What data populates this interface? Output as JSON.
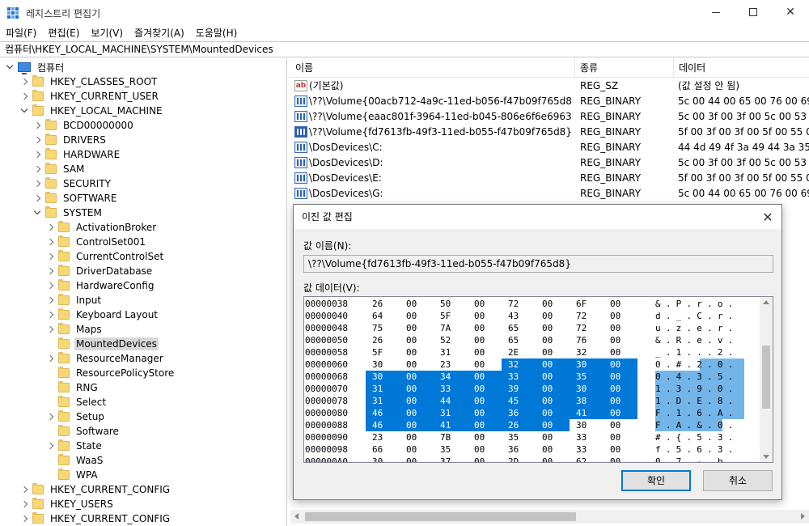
{
  "window": {
    "title": "레지스트리 편집기"
  },
  "menu": [
    "파일(F)",
    "편집(E)",
    "보기(V)",
    "즐겨찾기(A)",
    "도움말(H)"
  ],
  "address": "컴퓨터\\HKEY_LOCAL_MACHINE\\SYSTEM\\MountedDevices",
  "tree": {
    "root": "컴퓨터",
    "hives": [
      "HKEY_CLASSES_ROOT",
      "HKEY_CURRENT_USER",
      "HKEY_LOCAL_MACHINE",
      "HKEY_USERS",
      "HKEY_CURRENT_CONFIG"
    ],
    "hklm_children": [
      "BCD00000000",
      "DRIVERS",
      "HARDWARE",
      "SAM",
      "SECURITY",
      "SOFTWARE",
      "SYSTEM"
    ],
    "system_children": [
      "ActivationBroker",
      "ControlSet001",
      "CurrentControlSet",
      "DriverDatabase",
      "HardwareConfig",
      "Input",
      "Keyboard Layout",
      "Maps",
      "MountedDevices",
      "ResourceManager",
      "ResourcePolicyStore",
      "RNG",
      "Select",
      "Setup",
      "Software",
      "State",
      "WaaS",
      "WPA"
    ],
    "selected": "MountedDevices"
  },
  "list": {
    "columns": [
      "이름",
      "종류",
      "데이터"
    ],
    "rows": [
      {
        "name": "(기본값)",
        "type": "REG_SZ",
        "data": "(값 설정 안 됨)",
        "icon": "string-icon"
      },
      {
        "name": "\\??\\Volume{00acb712-4a9c-11ed-b056-f47b09f765d8}",
        "type": "REG_BINARY",
        "data": "5c 00 44 00 65 00 76 00 69",
        "icon": "binary-icon"
      },
      {
        "name": "\\??\\Volume{eaac801f-3964-11ed-b045-806e6f6e6963}",
        "type": "REG_BINARY",
        "data": "5c 00 3f 00 3f 00 5c 00 53 0",
        "icon": "binary-icon"
      },
      {
        "name": "\\??\\Volume{fd7613fb-49f3-11ed-b055-f47b09f765d8}",
        "type": "REG_BINARY",
        "data": "5f 00 3f 00 3f 00 5f 00 55 00",
        "icon": "binary-icon"
      },
      {
        "name": "\\DosDevices\\C:",
        "type": "REG_BINARY",
        "data": "44 4d 49 4f 3a 49 44 3a 35 a",
        "icon": "binary-icon"
      },
      {
        "name": "\\DosDevices\\D:",
        "type": "REG_BINARY",
        "data": "5c 00 3f 00 3f 00 5c 00 53 0",
        "icon": "binary-icon"
      },
      {
        "name": "\\DosDevices\\E:",
        "type": "REG_BINARY",
        "data": "5f 00 3f 00 3f 00 5f 00 55 00",
        "icon": "binary-icon"
      },
      {
        "name": "\\DosDevices\\G:",
        "type": "REG_BINARY",
        "data": "5c 00 44 00 65 00 76 00 69",
        "icon": "binary-icon"
      }
    ]
  },
  "dialog": {
    "title": "이진 값 편집",
    "name_label": "값 이름(N):",
    "name_value": "\\??\\Volume{fd7613fb-49f3-11ed-b055-f47b09f765d8}",
    "data_label": "값 데이터(V):",
    "ok_label": "확인",
    "cancel_label": "취소",
    "hex_rows": [
      {
        "addr": "00000038",
        "bytes": [
          "26",
          "00",
          "50",
          "00",
          "72",
          "00",
          "6F",
          "00"
        ],
        "ascii": "&.P.r.o.",
        "sel_from": -1,
        "sel_to": -1
      },
      {
        "addr": "00000040",
        "bytes": [
          "64",
          "00",
          "5F",
          "00",
          "43",
          "00",
          "72",
          "00"
        ],
        "ascii": "d._.C.r.",
        "sel_from": -1,
        "sel_to": -1
      },
      {
        "addr": "00000048",
        "bytes": [
          "75",
          "00",
          "7A",
          "00",
          "65",
          "00",
          "72",
          "00"
        ],
        "ascii": "u.z.e.r.",
        "sel_from": -1,
        "sel_to": -1
      },
      {
        "addr": "00000050",
        "bytes": [
          "26",
          "00",
          "52",
          "00",
          "65",
          "00",
          "76",
          "00"
        ],
        "ascii": "&.R.e.v.",
        "sel_from": -1,
        "sel_to": -1
      },
      {
        "addr": "00000058",
        "bytes": [
          "5F",
          "00",
          "31",
          "00",
          "2E",
          "00",
          "32",
          "00"
        ],
        "ascii": "_.1...2.",
        "sel_from": -1,
        "sel_to": -1
      },
      {
        "addr": "00000060",
        "bytes": [
          "30",
          "00",
          "23",
          "00",
          "32",
          "00",
          "30",
          "00"
        ],
        "ascii": "0.#.2.0.",
        "sel_from": 4,
        "sel_to": 7
      },
      {
        "addr": "00000068",
        "bytes": [
          "30",
          "00",
          "34",
          "00",
          "33",
          "00",
          "35",
          "00"
        ],
        "ascii": "0.4.3.5.",
        "sel_from": 0,
        "sel_to": 7
      },
      {
        "addr": "00000070",
        "bytes": [
          "31",
          "00",
          "33",
          "00",
          "39",
          "00",
          "30",
          "00"
        ],
        "ascii": "1.3.9.0.",
        "sel_from": 0,
        "sel_to": 7
      },
      {
        "addr": "00000078",
        "bytes": [
          "31",
          "00",
          "44",
          "00",
          "45",
          "00",
          "38",
          "00"
        ],
        "ascii": "1.D.E.8.",
        "sel_from": 0,
        "sel_to": 7
      },
      {
        "addr": "00000080",
        "bytes": [
          "46",
          "00",
          "31",
          "00",
          "36",
          "00",
          "41",
          "00"
        ],
        "ascii": "F.1.6.A.",
        "sel_from": 0,
        "sel_to": 7
      },
      {
        "addr": "00000088",
        "bytes": [
          "46",
          "00",
          "41",
          "00",
          "26",
          "00",
          "30",
          "00"
        ],
        "ascii": "F.A.&.0.",
        "sel_from": 0,
        "sel_to": 5
      },
      {
        "addr": "00000090",
        "bytes": [
          "23",
          "00",
          "7B",
          "00",
          "35",
          "00",
          "33",
          "00"
        ],
        "ascii": "#.{.5.3.",
        "sel_from": -1,
        "sel_to": -1
      },
      {
        "addr": "00000098",
        "bytes": [
          "66",
          "00",
          "35",
          "00",
          "36",
          "00",
          "33",
          "00"
        ],
        "ascii": "f.5.6.3.",
        "sel_from": -1,
        "sel_to": -1
      },
      {
        "addr": "000000A0",
        "bytes": [
          "30",
          "00",
          "37",
          "00",
          "2D",
          "00",
          "62",
          "00"
        ],
        "ascii": "0.7.-.b.",
        "sel_from": -1,
        "sel_to": -1
      }
    ]
  },
  "colors": {
    "selection": "#0078d7",
    "tree_selected": "#d9d9d9"
  }
}
